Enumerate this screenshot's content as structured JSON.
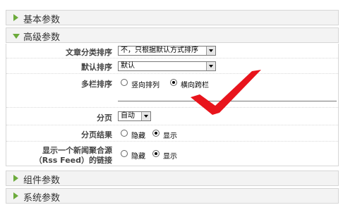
{
  "sections": {
    "basic": "基本参数",
    "advanced": "高级参数",
    "component": "组件参数",
    "system": "系统参数"
  },
  "advanced": {
    "article_sort_label": "文章分类排序",
    "article_sort_value": "不，只根据默认方式排序",
    "default_sort_label": "默认排序",
    "default_sort_value": "默认",
    "multicolumn_label": "多栏排序",
    "multicolumn_options": [
      "竖向排列",
      "横向跨栏"
    ],
    "pagination_label": "分页",
    "pagination_value": "自动",
    "pagination_results_label": "分页结果",
    "pagination_results_options": [
      "隐藏",
      "显示"
    ],
    "rss_label_line1": "显示一个新闻聚合源",
    "rss_label_line2": "（Rss Feed）的链接",
    "rss_options": [
      "隐藏",
      "显示"
    ]
  },
  "colors": {
    "accent_triangle": "#6cab3c",
    "checkmark": "#e8141c"
  },
  "icons": [
    "expand-right-triangle-icon",
    "collapse-down-triangle-icon",
    "red-checkmark-icon"
  ]
}
